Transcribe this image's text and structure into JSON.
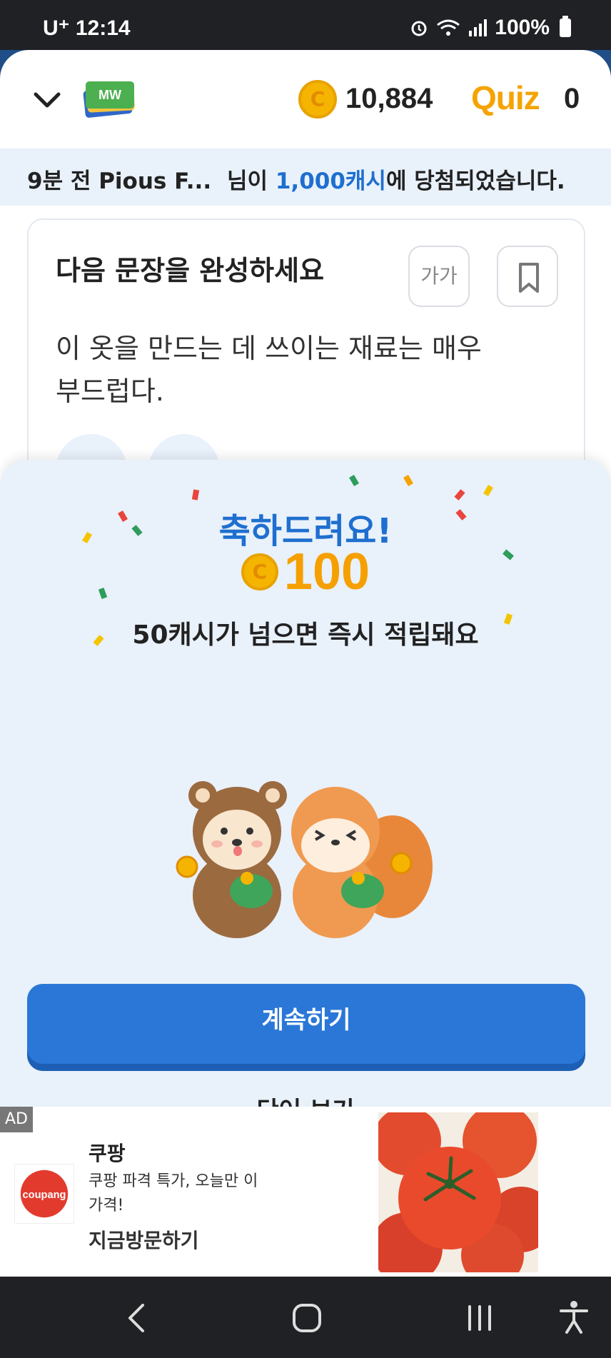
{
  "status_bar": {
    "carrier": "U⁺ 12:14",
    "battery": "100%"
  },
  "header": {
    "coin_balance": "10,884",
    "quiz_label": "Quiz",
    "quiz_count": "0",
    "coin_symbol": "C"
  },
  "ticker": {
    "user": "9분 전 Pious F...",
    "text_before": "님이 ",
    "amount": "1,000캐시",
    "text_after": "에 당첨되었습니다."
  },
  "quiz_card": {
    "title": "다음 문장을 완성하세요",
    "font_button": "가가",
    "sentence": "이 옷을 만드는 데 쓰이는 재료는 매우 부드럽다."
  },
  "popup": {
    "title": "축하드려요!",
    "reward_coin": "C",
    "reward_amount": "100",
    "subtitle": "50캐시가 넘으면 즉시 적립돼요",
    "continue_label": "계속하기",
    "view_words_label": "단어 보기"
  },
  "ad": {
    "tag": "AD",
    "brand": "쿠팡",
    "logo_text": "coupang",
    "description": "쿠팡 파격 특가, 오늘만 이 가격!",
    "cta": "지금방문하기"
  },
  "colors": {
    "primary_blue": "#2a77d8",
    "coin_gold": "#f5b400",
    "quiz_orange": "#f5a300",
    "popup_bg": "#e9f1fb"
  }
}
